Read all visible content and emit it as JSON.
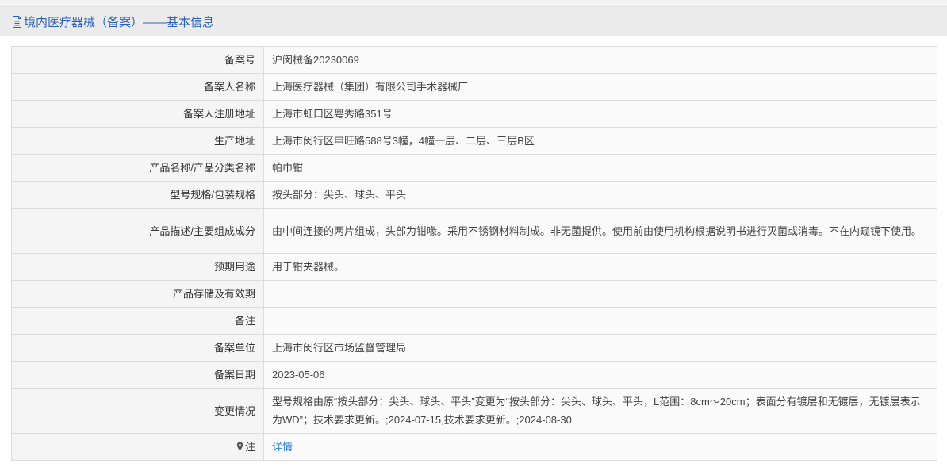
{
  "header": {
    "title": "境内医疗器械（备案）——基本信息"
  },
  "rows": [
    {
      "label": "备案号",
      "value": "沪闵械备20230069"
    },
    {
      "label": "备案人名称",
      "value": "上海医疗器械（集团）有限公司手术器械厂"
    },
    {
      "label": "备案人注册地址",
      "value": "上海市虹口区粤秀路351号"
    },
    {
      "label": "生产地址",
      "value": "上海市闵行区申旺路588号3幢，4幢一层、二层、三层B区"
    },
    {
      "label": "产品名称/产品分类名称",
      "value": "帕巾钳"
    },
    {
      "label": "型号规格/包装规格",
      "value": "按头部分：尖头、球头、平头"
    },
    {
      "label": "产品描述/主要组成成分",
      "value": "由中间连接的两片组成，头部为钳喙。采用不锈钢材料制成。非无菌提供。使用前由使用机构根据说明书进行灭菌或消毒。不在内窥镜下使用。"
    },
    {
      "label": "预期用途",
      "value": "用于钳夹器械。"
    },
    {
      "label": "产品存储及有效期",
      "value": ""
    },
    {
      "label": "备注",
      "value": ""
    },
    {
      "label": "备案单位",
      "value": "上海市闵行区市场监督管理局"
    },
    {
      "label": "备案日期",
      "value": "2023-05-06"
    },
    {
      "label": "变更情况",
      "value": "型号规格由原“按头部分：尖头、球头、平头”变更为“按头部分：尖头、球头、平头，L范围：8cm～20cm；表面分有镀层和无镀层，无镀层表示为WD”；技术要求更新。;2024-07-15,技术要求更新。;2024-08-30"
    }
  ],
  "note": {
    "label": "注",
    "link_text": "详情",
    "icon": "pin-icon"
  }
}
